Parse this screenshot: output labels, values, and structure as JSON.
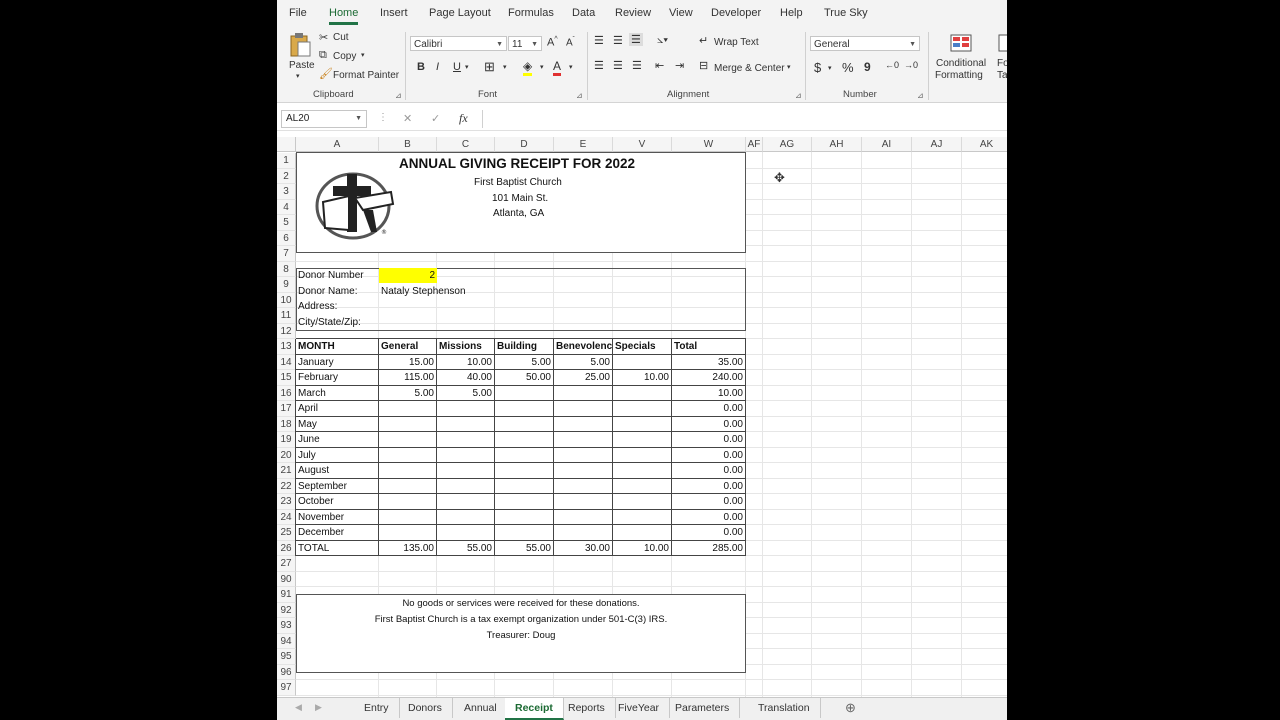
{
  "menu": {
    "tabs": [
      "File",
      "Home",
      "Insert",
      "Page Layout",
      "Formulas",
      "Data",
      "Review",
      "View",
      "Developer",
      "Help",
      "True Sky"
    ],
    "active": "Home"
  },
  "ribbon": {
    "clipboard": {
      "paste": "Paste",
      "cut": "Cut",
      "copy": "Copy",
      "format_painter": "Format Painter",
      "label": "Clipboard"
    },
    "font": {
      "name": "Calibri",
      "size": "11",
      "label": "Font",
      "bold": "B",
      "italic": "I",
      "underline": "U"
    },
    "alignment": {
      "wrap": "Wrap Text",
      "merge": "Merge & Center",
      "label": "Alignment"
    },
    "number": {
      "format": "General",
      "currency": "$",
      "percent": "%",
      "comma": "9",
      "label": "Number"
    },
    "styles": {
      "conditional": "Conditional",
      "formatting": "Formatting",
      "format_table_1": "For",
      "format_table_2": "Ta"
    }
  },
  "formula_bar": {
    "name_box": "AL20",
    "cancel": "✕",
    "enter": "✓",
    "fx": "fx",
    "value": ""
  },
  "columns": [
    "A",
    "B",
    "C",
    "D",
    "E",
    "V",
    "W",
    "AF",
    "AG",
    "AH",
    "AI",
    "AJ",
    "AK"
  ],
  "rows": [
    "1",
    "2",
    "3",
    "4",
    "5",
    "6",
    "7",
    "8",
    "9",
    "10",
    "11",
    "12",
    "13",
    "14",
    "15",
    "16",
    "17",
    "18",
    "19",
    "20",
    "21",
    "22",
    "23",
    "24",
    "25",
    "26",
    "27",
    "90",
    "91",
    "92",
    "93",
    "94",
    "95",
    "96",
    "97"
  ],
  "receipt": {
    "title": "ANNUAL GIVING RECEIPT FOR 2022",
    "church": "First Baptist Church",
    "address": "101 Main St.",
    "city": "Atlanta, GA",
    "donor_number_label": "Donor Number",
    "donor_number": "2",
    "donor_name_label": "Donor Name:",
    "donor_name": "Nataly Stephenson",
    "address_label": "Address:",
    "city_label": "City/State/Zip:",
    "headers": [
      "MONTH",
      "General",
      "Missions",
      "Building",
      "Benevolenc",
      "Specials",
      "Total"
    ],
    "months": [
      {
        "m": "January",
        "v": [
          "15.00",
          "10.00",
          "5.00",
          "5.00",
          "",
          "35.00"
        ]
      },
      {
        "m": "February",
        "v": [
          "115.00",
          "40.00",
          "50.00",
          "25.00",
          "10.00",
          "240.00"
        ]
      },
      {
        "m": "March",
        "v": [
          "5.00",
          "5.00",
          "",
          "",
          "",
          "10.00"
        ]
      },
      {
        "m": "April",
        "v": [
          "",
          "",
          "",
          "",
          "",
          "0.00"
        ]
      },
      {
        "m": "May",
        "v": [
          "",
          "",
          "",
          "",
          "",
          "0.00"
        ]
      },
      {
        "m": "June",
        "v": [
          "",
          "",
          "",
          "",
          "",
          "0.00"
        ]
      },
      {
        "m": "July",
        "v": [
          "",
          "",
          "",
          "",
          "",
          "0.00"
        ]
      },
      {
        "m": "August",
        "v": [
          "",
          "",
          "",
          "",
          "",
          "0.00"
        ]
      },
      {
        "m": "September",
        "v": [
          "",
          "",
          "",
          "",
          "",
          "0.00"
        ]
      },
      {
        "m": "October",
        "v": [
          "",
          "",
          "",
          "",
          "",
          "0.00"
        ]
      },
      {
        "m": "November",
        "v": [
          "",
          "",
          "",
          "",
          "",
          "0.00"
        ]
      },
      {
        "m": "December",
        "v": [
          "",
          "",
          "",
          "",
          "",
          "0.00"
        ]
      }
    ],
    "total_label": "TOTAL",
    "totals": [
      "135.00",
      "55.00",
      "55.00",
      "30.00",
      "10.00",
      "285.00"
    ],
    "footer1": "No goods or services were received for these donations.",
    "footer2": "First Baptist Church is a tax exempt organization under 501-C(3) IRS.",
    "footer3": "Treasurer:   Doug"
  },
  "sheets": {
    "tabs": [
      "Entry",
      "Donors",
      "Annual",
      "Receipt",
      "Reports",
      "FiveYear",
      "Parameters",
      "Translation"
    ],
    "active": "Receipt"
  },
  "colors": {
    "excel_green": "#217346",
    "highlight": "#ffff00"
  }
}
